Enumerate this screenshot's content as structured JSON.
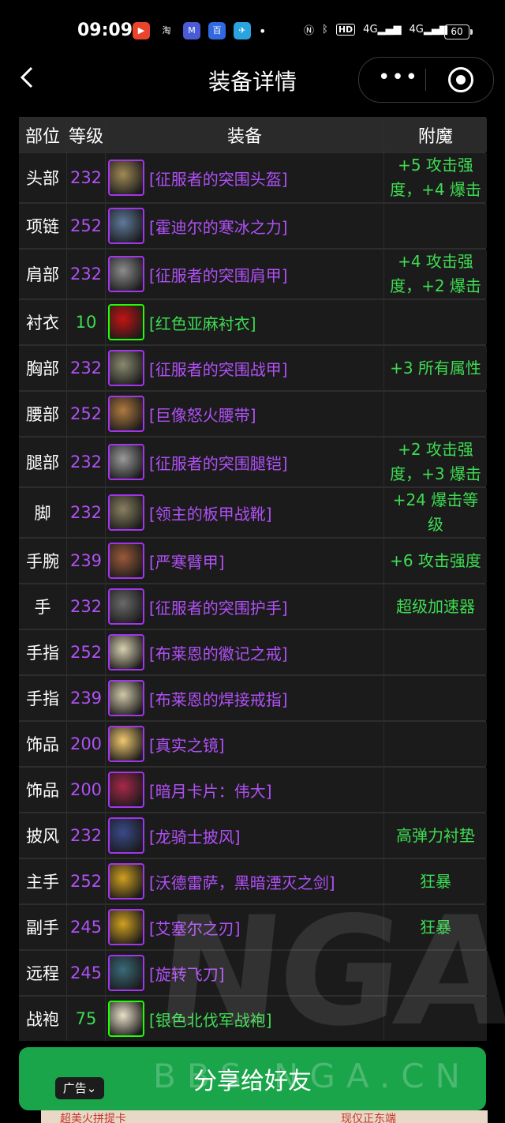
{
  "status_bar": {
    "time": "09:09",
    "network": "4G",
    "network2": "4G",
    "battery": "60",
    "apps": [
      {
        "icon": "video-app-icon",
        "color": "#e8452c",
        "label": "▶"
      },
      {
        "icon": "taobao-icon",
        "color": "#000000",
        "label": "淘"
      },
      {
        "icon": "app-icon",
        "color": "#4a5bd6",
        "label": "M"
      },
      {
        "icon": "baidu-icon",
        "color": "#3169e0",
        "label": "百"
      },
      {
        "icon": "telegram-icon",
        "color": "#2aa3df",
        "label": "✈"
      }
    ]
  },
  "nav": {
    "title": "装备详情",
    "back_icon": "chevron-left-icon",
    "more_icon": "more-dots-icon",
    "close_icon": "close-miniprogram-icon"
  },
  "table": {
    "headers": [
      "部位",
      "等级",
      "装备",
      "附魔"
    ],
    "rows": [
      {
        "slot": "头部",
        "level": "232",
        "name": "[征服者的突围头盔]",
        "enchant": "+5 攻击强度，+4 爆击",
        "quality": "purple",
        "icon_color": "#a08a55"
      },
      {
        "slot": "项链",
        "level": "252",
        "name": "[霍迪尔的寒冰之力]",
        "enchant": "",
        "quality": "purple",
        "icon_color": "#5f7a9a"
      },
      {
        "slot": "肩部",
        "level": "232",
        "name": "[征服者的突围肩甲]",
        "enchant": "+4 攻击强度，+2 爆击",
        "quality": "purple",
        "icon_color": "#8c8c8c"
      },
      {
        "slot": "衬衣",
        "level": "10",
        "name": "[红色亚麻衬衣]",
        "enchant": "",
        "quality": "green",
        "icon_color": "#c41414"
      },
      {
        "slot": "胸部",
        "level": "232",
        "name": "[征服者的突围战甲]",
        "enchant": "+3 所有属性",
        "quality": "purple",
        "icon_color": "#8a8a70"
      },
      {
        "slot": "腰部",
        "level": "252",
        "name": "[巨像怒火腰带]",
        "enchant": "",
        "quality": "purple",
        "icon_color": "#b07a40"
      },
      {
        "slot": "腿部",
        "level": "232",
        "name": "[征服者的突围腿铠]",
        "enchant": "+2 攻击强度，+3 爆击",
        "quality": "purple",
        "icon_color": "#9a9a9a"
      },
      {
        "slot": "脚",
        "level": "232",
        "name": "[领主的板甲战靴]",
        "enchant": "+24 爆击等级",
        "quality": "purple",
        "icon_color": "#8a8060"
      },
      {
        "slot": "手腕",
        "level": "239",
        "name": "[严寒臂甲]",
        "enchant": "+6 攻击强度",
        "quality": "purple",
        "icon_color": "#9a5a3a"
      },
      {
        "slot": "手",
        "level": "232",
        "name": "[征服者的突围护手]",
        "enchant": "超级加速器",
        "quality": "purple",
        "icon_color": "#6a6a6a"
      },
      {
        "slot": "手指",
        "level": "252",
        "name": "[布莱恩的徽记之戒]",
        "enchant": "",
        "quality": "purple",
        "icon_color": "#d8d0b0"
      },
      {
        "slot": "手指",
        "level": "239",
        "name": "[布莱恩的焊接戒指]",
        "enchant": "",
        "quality": "purple",
        "icon_color": "#d0c8a8"
      },
      {
        "slot": "饰品",
        "level": "200",
        "name": "[真实之镜]",
        "enchant": "",
        "quality": "purple",
        "icon_color": "#f0c870"
      },
      {
        "slot": "饰品",
        "level": "200",
        "name": "[暗月卡片：伟大]",
        "enchant": "",
        "quality": "purple",
        "icon_color": "#a8284a"
      },
      {
        "slot": "披风",
        "level": "232",
        "name": "[龙骑士披风]",
        "enchant": "高弹力衬垫",
        "quality": "purple",
        "icon_color": "#3a4a8a"
      },
      {
        "slot": "主手",
        "level": "252",
        "name": "[沃德雷萨，黑暗湮灭之剑]",
        "enchant": "狂暴",
        "quality": "purple",
        "icon_color": "#d0a020"
      },
      {
        "slot": "副手",
        "level": "245",
        "name": "[艾塞尔之刃]",
        "enchant": "狂暴",
        "quality": "purple",
        "icon_color": "#d0a020"
      },
      {
        "slot": "远程",
        "level": "245",
        "name": "[旋转飞刀]",
        "enchant": "",
        "quality": "purple",
        "icon_color": "#3a6a7a"
      },
      {
        "slot": "战袍",
        "level": "75",
        "name": "[银色北伐军战袍]",
        "enchant": "",
        "quality": "green",
        "icon_color": "#e8e0c8"
      }
    ]
  },
  "watermark": "NGA",
  "share": {
    "label": "分享给好友",
    "watermark": "BBS.NGA.CN",
    "ad_badge": "广告"
  },
  "ad_strip": {
    "left_text": "超美火拼提卡",
    "right_text": "现仅正东端"
  },
  "colors": {
    "epic": "#b050f5",
    "uncommon": "#3edb52",
    "share_button": "#1aa54a"
  }
}
